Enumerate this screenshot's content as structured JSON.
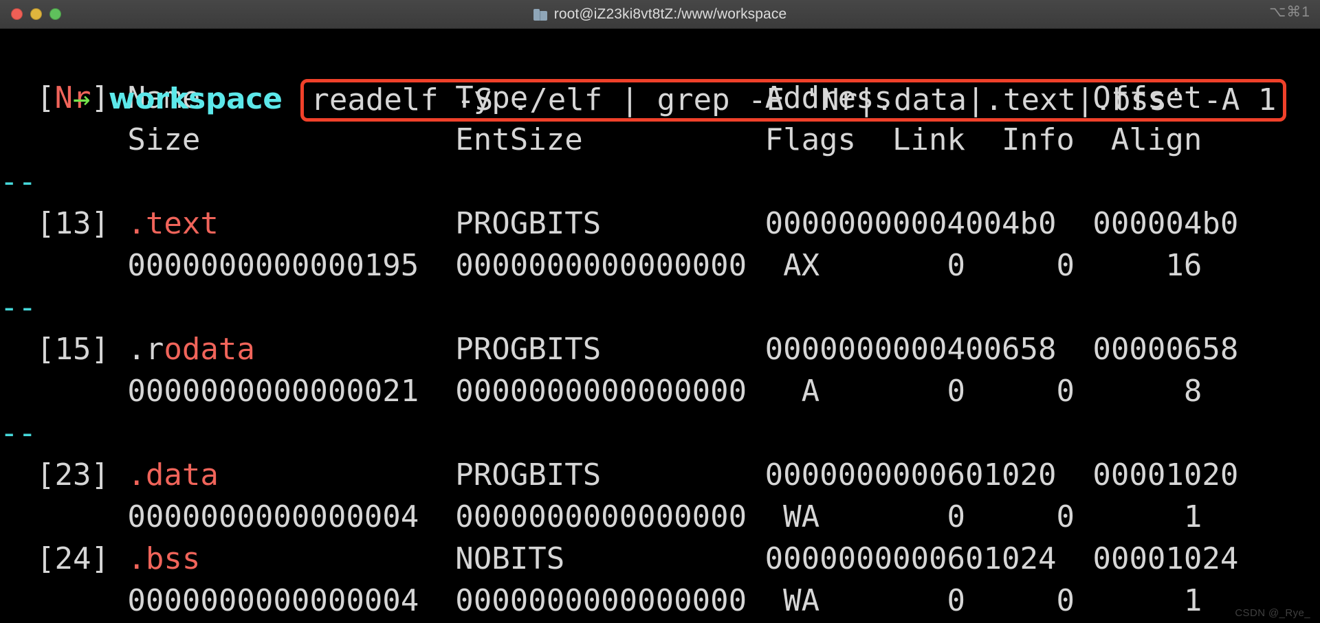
{
  "titlebar": {
    "traffic_lights": [
      "close",
      "minimize",
      "maximize"
    ],
    "folder_icon": "folder-icon",
    "title": "root@iZ23ki8vt8tZ:/www/workspace",
    "shortcut_hint": "⌥⌘1",
    "colors": {
      "close": "#ef5f56",
      "minimize": "#e0b53d",
      "maximize": "#5fc15c",
      "bar": "#424242"
    }
  },
  "terminal": {
    "colors": {
      "background": "#000000",
      "foreground": "#d6d6d6",
      "match_red": "#f0645a",
      "separator_cyan": "#46d8da",
      "prompt_cyan": "#5ce8ea",
      "arrow_green": "#74e24b",
      "highlight_box": "#f0412a"
    },
    "prompt": {
      "arrow": "→",
      "cwd": "workspace",
      "command": "readelf -S ./elf | grep -E 'Nr|.data|.text|.bss' -A 1"
    },
    "header": {
      "line1": {
        "bracket_open": "  [",
        "nr": "Nr",
        "bracket_close": "] Name              Type             Address           Offset"
      },
      "line2": "       Size              EntSize          Flags  Link  Info  Align"
    },
    "separator": "--",
    "sections": [
      {
        "index": "  [13] ",
        "name_plain": "",
        "name_match": ".text",
        "name_pad": "             ",
        "type": "PROGBITS",
        "type_pad": "         ",
        "address": "00000000004004b0",
        "offset": "  000004b0",
        "size": "       0000000000000195",
        "entsize": "  0000000000000000",
        "flags": "  AX",
        "link": "       0",
        "info": "     0",
        "align": "     16"
      },
      {
        "index": "  [15] ",
        "name_plain": ".r",
        "name_match": "odata",
        "name_pad": "           ",
        "type": "PROGBITS",
        "type_pad": "         ",
        "address": "0000000000400658",
        "offset": "  00000658",
        "size": "       0000000000000021",
        "entsize": "  0000000000000000",
        "flags": "   A",
        "link": "       0",
        "info": "     0",
        "align": "      8"
      },
      {
        "index": "  [23] ",
        "name_plain": "",
        "name_match": ".data",
        "name_pad": "             ",
        "type": "PROGBITS",
        "type_pad": "         ",
        "address": "0000000000601020",
        "offset": "  00001020",
        "size": "       0000000000000004",
        "entsize": "  0000000000000000",
        "flags": "  WA",
        "link": "       0",
        "info": "     0",
        "align": "      1"
      },
      {
        "index": "  [24] ",
        "name_plain": "",
        "name_match": ".bss",
        "name_pad": "              ",
        "type": "NOBITS",
        "type_pad": "           ",
        "address": "0000000000601024",
        "offset": "  00001024",
        "size": "       0000000000000004",
        "entsize": "  0000000000000000",
        "flags": "  WA",
        "link": "       0",
        "info": "     0",
        "align": "      1"
      }
    ],
    "row_layout": [
      {
        "kind": "separator"
      },
      {
        "kind": "section_head",
        "section": 0
      },
      {
        "kind": "section_body",
        "section": 0
      },
      {
        "kind": "separator"
      },
      {
        "kind": "section_head",
        "section": 1
      },
      {
        "kind": "section_body",
        "section": 1
      },
      {
        "kind": "separator"
      },
      {
        "kind": "section_head",
        "section": 2
      },
      {
        "kind": "section_body",
        "section": 2
      },
      {
        "kind": "section_head",
        "section": 3
      },
      {
        "kind": "section_body",
        "section": 3
      }
    ]
  },
  "watermark": "CSDN @_Rye_"
}
